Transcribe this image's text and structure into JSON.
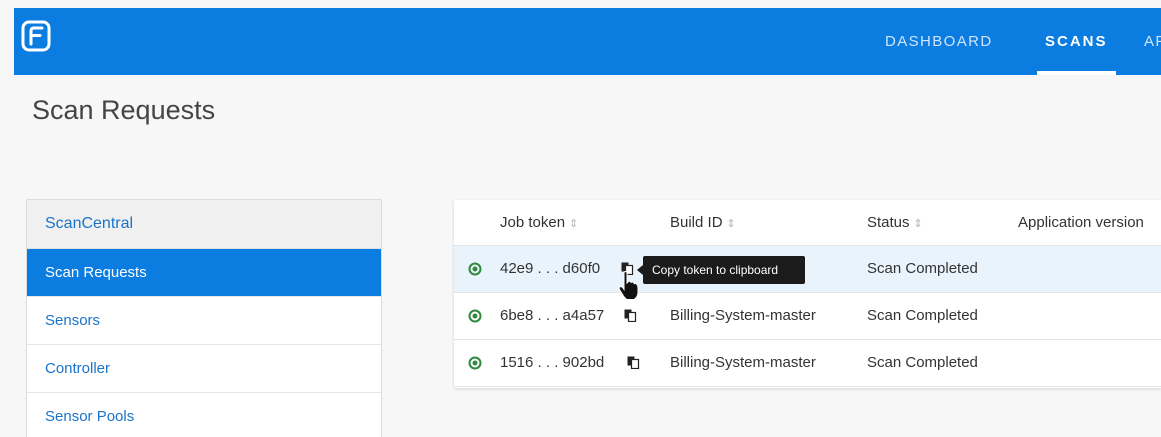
{
  "header": {
    "brand_color": "#0b7ce0",
    "logo_icon": "fortify-logo-icon",
    "nav": [
      {
        "label": "DASHBOARD",
        "active": false
      },
      {
        "label": "SCANS",
        "active": true
      },
      {
        "label": "AP",
        "active": false
      }
    ]
  },
  "page": {
    "title": "Scan Requests"
  },
  "sidebar": {
    "heading": "ScanCentral",
    "items": [
      {
        "label": "Scan Requests",
        "active": true
      },
      {
        "label": "Sensors",
        "active": false
      },
      {
        "label": "Controller",
        "active": false
      },
      {
        "label": "Sensor Pools",
        "active": false
      }
    ]
  },
  "table": {
    "columns": [
      {
        "label": "Job token",
        "sortable": true
      },
      {
        "label": "Build ID",
        "sortable": true
      },
      {
        "label": "Status",
        "sortable": true
      },
      {
        "label": "Application version",
        "sortable": false
      }
    ],
    "rows": [
      {
        "job_token": "42e9 . . . d60f0",
        "build_id": "",
        "status": "Scan Completed",
        "app_version": ""
      },
      {
        "job_token": "6be8 . . . a4a57",
        "build_id": "Billing-System-master",
        "status": "Scan Completed",
        "app_version": ""
      },
      {
        "job_token": "1516 . . . 902bd",
        "build_id": "Billing-System-master",
        "status": "Scan Completed",
        "app_version": ""
      }
    ],
    "status_color": "#2e8b3e"
  },
  "tooltip": {
    "text": "Copy token to clipboard"
  }
}
